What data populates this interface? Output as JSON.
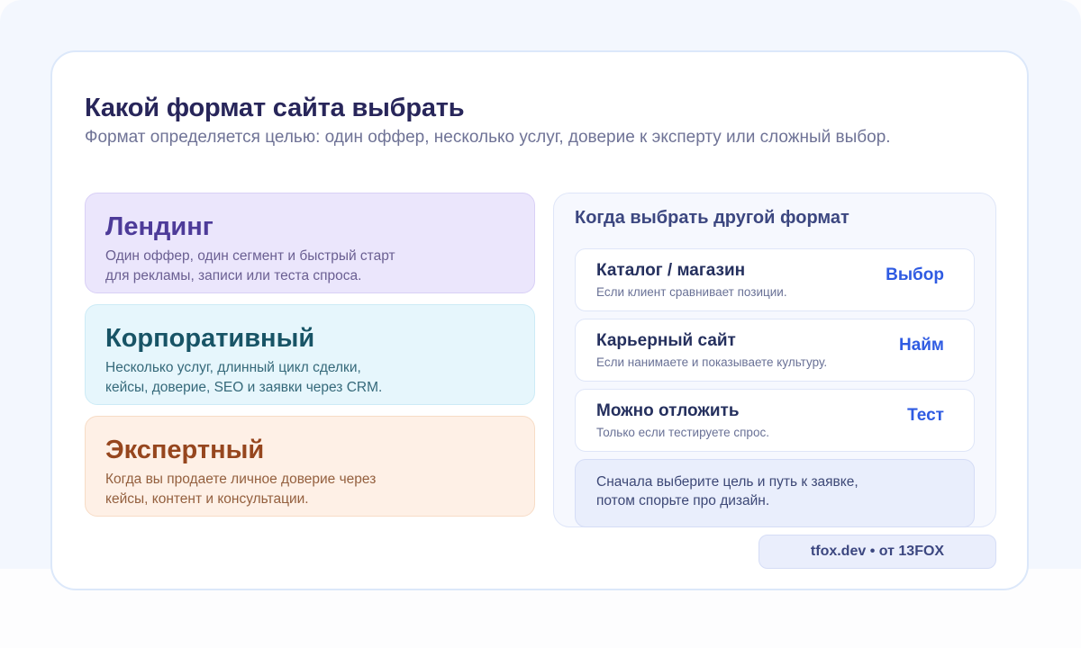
{
  "header": {
    "title": "Какой формат сайта выбрать",
    "subtitle": "Формат определяется целью: один оффер, несколько услуг, доверие к эксперту или сложный выбор."
  },
  "formats": [
    {
      "name": "Лендинг",
      "desc_line1": "Один оффер, один сегмент и быстрый старт",
      "desc_line2": "для рекламы, записи или теста спроса."
    },
    {
      "name": "Корпоративный",
      "desc_line1": "Несколько услуг, длинный цикл сделки,",
      "desc_line2": "кейсы, доверие, SEO и заявки через CRM."
    },
    {
      "name": "Экспертный",
      "desc_line1": "Когда вы продаете личное доверие через",
      "desc_line2": "кейсы, контент и консультации."
    }
  ],
  "alternatives": {
    "title": "Когда выбрать другой формат",
    "options": [
      {
        "name": "Каталог / магазин",
        "desc": "Если клиент сравнивает позиции.",
        "tag": "Выбор"
      },
      {
        "name": "Карьерный сайт",
        "desc": "Если нанимаете и показываете культуру.",
        "tag": "Найм"
      },
      {
        "name": "Можно отложить",
        "desc": "Только если тестируете спрос.",
        "tag": "Тест"
      }
    ],
    "note_line1": "Сначала выберите цель и путь к заявке,",
    "note_line2": "потом спорьте про дизайн."
  },
  "footer": {
    "credit": "tfox.dev • от 13FOX"
  },
  "colors": {
    "background": "#f3f7fe",
    "title": "#28265a",
    "accent": "#2f5be2",
    "landing_bg": "#ebe6fc",
    "corporate_bg": "#e6f6fc",
    "expert_bg": "#fef0e6"
  }
}
